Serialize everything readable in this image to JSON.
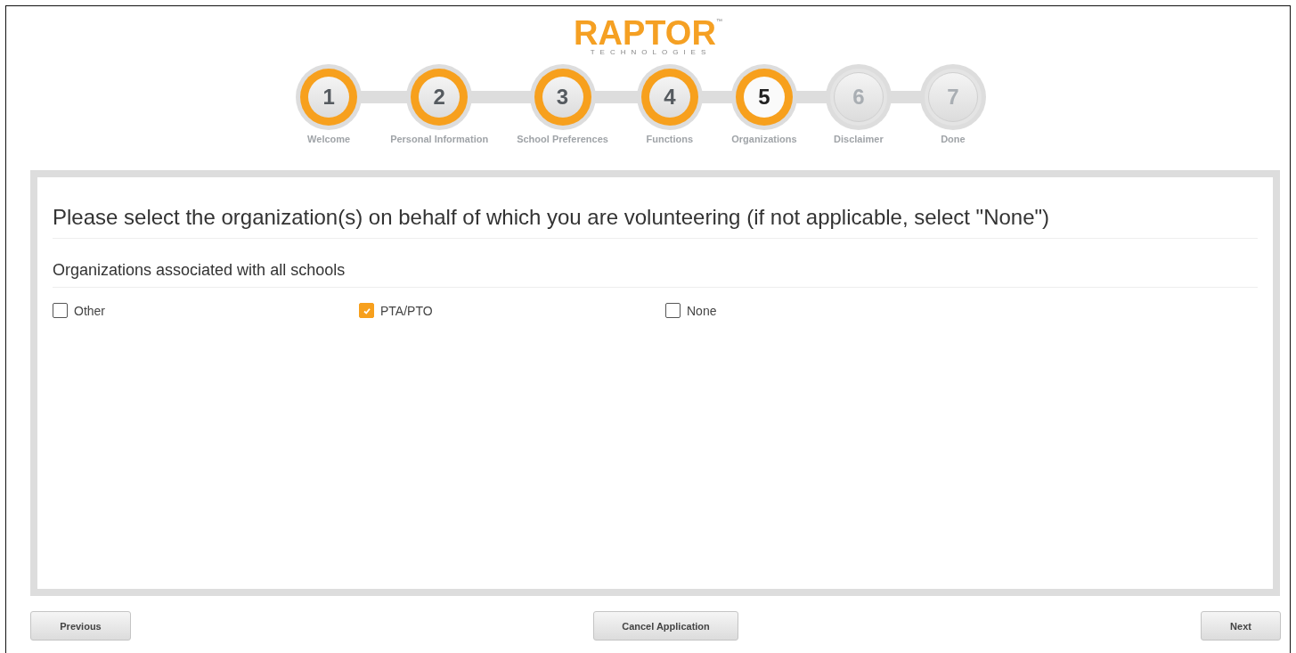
{
  "logo": {
    "name": "RAPTOR",
    "mark": "™",
    "tagline": "TECHNOLOGIES"
  },
  "steps": [
    {
      "number": "1",
      "label": "Welcome",
      "done": true,
      "selected": false
    },
    {
      "number": "2",
      "label": "Personal Information",
      "done": true,
      "selected": false
    },
    {
      "number": "3",
      "label": "School Preferences",
      "done": true,
      "selected": false
    },
    {
      "number": "4",
      "label": "Functions",
      "done": true,
      "selected": false
    },
    {
      "number": "5",
      "label": "Organizations",
      "done": true,
      "selected": true
    },
    {
      "number": "6",
      "label": "Disclaimer",
      "done": false,
      "selected": false
    },
    {
      "number": "7",
      "label": "Done",
      "done": false,
      "selected": false
    }
  ],
  "heading": "Please select the organization(s) on behalf of which you are volunteering (if not applicable, select \"None\")",
  "section": "Organizations associated with all schools",
  "options": [
    {
      "label": "Other",
      "checked": false
    },
    {
      "label": "PTA/PTO",
      "checked": true
    },
    {
      "label": "None",
      "checked": false
    }
  ],
  "buttons": {
    "previous": "Previous",
    "cancel": "Cancel Application",
    "next": "Next"
  }
}
